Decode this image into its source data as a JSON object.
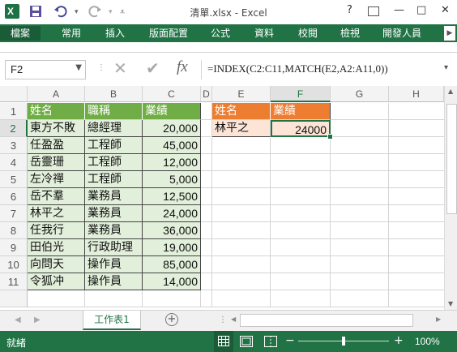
{
  "window": {
    "title": "清單.xlsx - Excel",
    "help_label": "?",
    "restore_label": "⧉",
    "minimize_label": "—",
    "maximize_label": "□",
    "close_label": "✕"
  },
  "qat": {
    "app_icon": "excel-icon",
    "save_icon": "save-icon",
    "undo_icon": "undo-icon",
    "redo_icon": "redo-icon",
    "customize_icon": "customize-icon"
  },
  "ribbon": {
    "tabs": [
      "檔案",
      "常用",
      "插入",
      "版面配置",
      "公式",
      "資料",
      "校閱",
      "檢視",
      "開發人員"
    ],
    "scroll_right": "▶"
  },
  "formula_bar": {
    "name_box": "F2",
    "cancel_icon": "✕",
    "enter_icon": "✔",
    "fx_label": "fx",
    "formula": "=INDEX(C2:C11,MATCH(E2,A2:A11,0))"
  },
  "grid": {
    "columns": [
      "A",
      "B",
      "C",
      "D",
      "E",
      "F",
      "G",
      "H"
    ],
    "rows": [
      "1",
      "2",
      "3",
      "4",
      "5",
      "6",
      "7",
      "8",
      "9",
      "10",
      "11"
    ],
    "table1": {
      "headers": [
        "姓名",
        "職稱",
        "業績"
      ],
      "rows": [
        [
          "東方不敗",
          "總經理",
          "20,000"
        ],
        [
          "任盈盈",
          "工程師",
          "45,000"
        ],
        [
          "岳靈珊",
          "工程師",
          "12,000"
        ],
        [
          "左冷禪",
          "工程師",
          "5,000"
        ],
        [
          "岳不羣",
          "業務員",
          "12,500"
        ],
        [
          "林平之",
          "業務員",
          "24,000"
        ],
        [
          "任我行",
          "業務員",
          "36,000"
        ],
        [
          "田伯光",
          "行政助理",
          "19,000"
        ],
        [
          "向問天",
          "操作員",
          "85,000"
        ],
        [
          "令狐冲",
          "操作員",
          "14,000"
        ]
      ]
    },
    "table2": {
      "headers": [
        "姓名",
        "業績"
      ],
      "row": [
        "林平之",
        "24000"
      ]
    }
  },
  "sheet_tabs": {
    "active": "工作表1",
    "add_label": "+"
  },
  "status": {
    "mode": "就緒",
    "zoom": "100%",
    "zoom_minus": "−",
    "zoom_plus": "+"
  },
  "colors": {
    "brand": "#217346",
    "table1_header": "#70ad47",
    "table1_body": "#e2efda",
    "table2_header": "#ed7d31",
    "table2_body": "#fce4d6"
  }
}
